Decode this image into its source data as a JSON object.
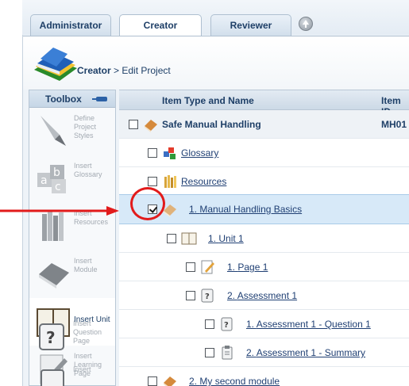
{
  "tabs": [
    {
      "label": "Administrator",
      "active": false
    },
    {
      "label": "Creator",
      "active": true
    },
    {
      "label": "Reviewer",
      "active": false
    }
  ],
  "breadcrumb": {
    "section": "Creator",
    "separator": " > ",
    "page": "Edit Project"
  },
  "toolbox": {
    "title": "Toolbox",
    "tools": [
      {
        "label": "Define Project Styles",
        "enabled": false
      },
      {
        "label": "Insert Glossary",
        "enabled": false
      },
      {
        "label": "Insert Resources",
        "enabled": false
      },
      {
        "label": "Insert Module",
        "enabled": false
      },
      {
        "label": "Insert Unit",
        "enabled": true
      },
      {
        "label": "Insert Learning Page",
        "enabled": false
      },
      {
        "label": "Insert Question Page",
        "enabled": false
      },
      {
        "label": "Insert",
        "enabled": false
      }
    ]
  },
  "grid": {
    "col_name": "Item Type and Name",
    "col_id": "Item ID",
    "rows": [
      {
        "name": "Safe Manual Handling",
        "id": "MH01",
        "checked": false,
        "icon": "book-icon"
      },
      {
        "name": "Glossary",
        "checked": false,
        "icon": "glossary-icon"
      },
      {
        "name": "Resources",
        "checked": false,
        "icon": "resources-icon"
      },
      {
        "number": "1.",
        "name": "Manual Handling Basics",
        "checked": true,
        "icon": "module-icon"
      },
      {
        "number": "1.",
        "name": "Unit 1",
        "checked": false,
        "icon": "unit-icon"
      },
      {
        "number": "1.",
        "name": "Page 1",
        "checked": false,
        "icon": "page-icon"
      },
      {
        "number": "2.",
        "name": "Assessment 1",
        "checked": false,
        "icon": "assessment-icon"
      },
      {
        "number": "1.",
        "name": "Assessment 1 - Question 1",
        "checked": false,
        "icon": "question-icon"
      },
      {
        "number": "2.",
        "name": "Assessment 1 - Summary",
        "checked": false,
        "icon": "summary-icon"
      },
      {
        "number": "2.",
        "name": "My second module",
        "checked": false,
        "icon": "module-icon"
      }
    ]
  },
  "colors": {
    "annotation": "#e21b1b",
    "accent": "#1e3f67",
    "selected_row": "#d7e9f8"
  }
}
